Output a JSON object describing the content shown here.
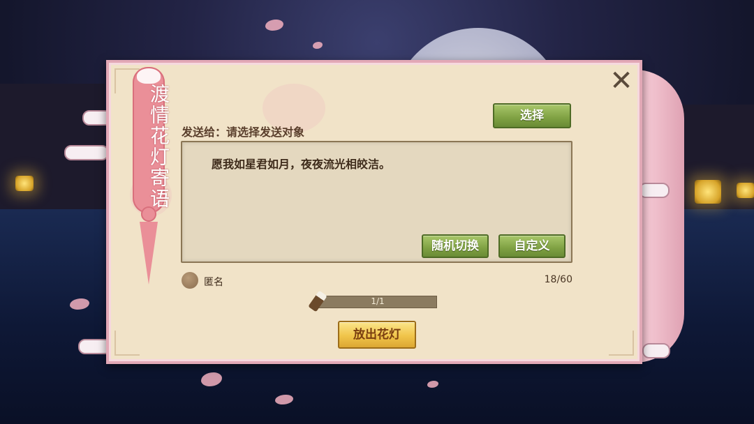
{
  "panel": {
    "title": "渡情花灯寄语",
    "close_label": "✕"
  },
  "recipient": {
    "label": "发送给：请选择发送对象",
    "select_button": "选择"
  },
  "message": {
    "text": "愿我如星君如月，夜夜流光相皎洁。",
    "random_button": "随机切换",
    "custom_button": "自定义",
    "char_count": "18/60"
  },
  "anonymous": {
    "label": "匿名"
  },
  "progress": {
    "text": "1/1",
    "fraction": 1.0
  },
  "release_button": "放出花灯",
  "colors": {
    "panel_bg": "#f1e3c8",
    "accent_pink": "#ea8f98",
    "green_button": "#7fa143",
    "gold_button": "#f0c44a"
  }
}
